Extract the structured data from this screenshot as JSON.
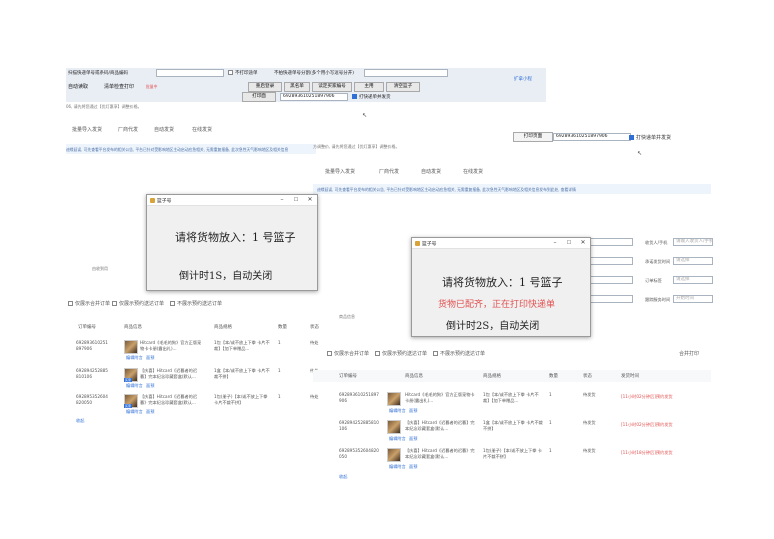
{
  "left": {
    "toolbar": {
      "hint_scan": "扫描快递单号或条码/商品编码 ",
      "print_label_chk": "不打印途单",
      "hint_small": "不拍快递单号分割(多个用小写逗号分开)",
      "cut_text": "扩拿小程",
      "btn_read_order": "自动读取",
      "btn_clear_print": "清单检查打印",
      "check_tag": "批量中",
      "btn_recheck": "重启登录",
      "btn_blacklist": "黑名单",
      "btn_confirm_vip": "读定买家编号",
      "btn_main": "主用",
      "btn_clear_basket": "清空篮子",
      "btn_print_page": "打印面",
      "code_value": "692893610251897906",
      "print_quick_chk": "打快递单并发货",
      "note": "06,  请先将您通过【优灯惠享】调整价格。"
    },
    "tabs": [
      "批量导入发货",
      "厂商代发",
      "自动发货",
      "在线发货"
    ],
    "notice": "迪缘延误,  可先查看平台发布的相关公告,  平台已针对受影响地区主动启动应急相关,  无需重复报备,  此次急性天气影响地区及相关信息",
    "filter_hint": "由收到用",
    "options": [
      "仅展示合并订单",
      "仅展示预约送达订单",
      "不展示预约送达订单"
    ],
    "columns": [
      "订单编号",
      "商品信息",
      "商品规格",
      "数量",
      "状态"
    ],
    "rows": [
      {
        "order": "692893610251897906",
        "title": "Hitcard《毛毛的狗》官方正版宠物卡卡册(露出礼)...",
        "spec": "1包【本/或不放上下拳 卡片不裁】【加下单赠品...",
        "qty": "1",
        "status": "待处"
      },
      {
        "order": "692894252885810106",
        "title": "【庆喜】Hitcard《迟暮者的迟暮】完本纪念珍藏套盒(默认...",
        "spec": "1盒【本/或不放上下拳 卡片不裁不拼】",
        "qty": "1",
        "status": "待处"
      },
      {
        "order": "692895352604820050",
        "title": "【庆喜】Hitcard《迟暮者的迟暮》完本纪念珍藏套盒(默认...",
        "spec": "1包(册子)【本/或不放上下拳 卡片不裁不拼】",
        "qty": "1",
        "status": "待处"
      }
    ],
    "links": [
      "编辑附言",
      "面预"
    ],
    "expand": "收起",
    "buyer_icon": "买家"
  },
  "dialog_left": {
    "title": "篮子号",
    "line1": "请将货物放入：1 号篮子",
    "line2": "倒计时1S，自动关闭"
  },
  "dialog_right": {
    "title": "篮子号",
    "line1": "请将货物放入：1 号篮子",
    "line_red": "货物已配齐，正在打印快递单",
    "line2": "倒计时2S，自动关闭"
  },
  "right": {
    "btn_print_page": "打印页面",
    "code_value": "692893610251897906",
    "print_quick_chk": "打快递单并发货",
    "note": "方调整价,  请先将您通过【优灯惠享】调整价格。",
    "tabs": [
      "批量导入发货",
      "厂商代发",
      "自动发货",
      "在线发货"
    ],
    "notice": "迪缘延误,  可先查看平台发布的相关公告,  平台已针对受影响地区主动启动应急相关,  无需重复报备,  此次急性天气影响地区及相关信息发布到此处,  查看详情",
    "fields": [
      {
        "label": "收货人/手机",
        "placeholder": "请输入收货人/手机"
      },
      {
        "label": "承诺发货时间",
        "placeholder": "请选择"
      },
      {
        "label": "订单标签",
        "placeholder": "请选择"
      },
      {
        "label": "跟踪服务时间",
        "placeholder": "开始时间"
      }
    ],
    "filter_hint": "商品信息",
    "options": [
      "仅展示合并订单",
      "仅展示预约送达订单",
      "不展示预约送达订单"
    ],
    "merge_print": "合并打印",
    "columns": [
      "订单编号",
      "商品信息",
      "商品规格",
      "数量",
      "状态",
      "发货时间"
    ],
    "rows": [
      {
        "order": "692893610251897906",
        "title": "Hitcard《毛毛的狗》官方正版宠物卡卡册(露出礼)...",
        "spec": "1包【本/或不放上下拳 卡片不裁】【加下单赠品...",
        "qty": "1",
        "status": "待发货",
        "ship": "[11小时02分钟后]预约发货"
      },
      {
        "order": "692894252885810106",
        "title": "【庆喜】Hitcard《迟暮者的迟暮】完本纪念珍藏套盒(默认...",
        "spec": "1盒【本/或不放上下拳 卡片不裁不拼】",
        "qty": "1",
        "status": "待发货",
        "ship": "[11小时02分钟后]预约发货"
      },
      {
        "order": "692895352604820050",
        "title": "【庆喜】Hitcard《迟暮者的迟暮》完本纪念珍藏套盒(默认...",
        "spec": "1包(册子)【本/或不放上下拳 卡片不裁不拼】",
        "qty": "1",
        "status": "待发货",
        "ship": "[11小时18分钟后]预约发货"
      }
    ],
    "links": [
      "编辑附言",
      "面预"
    ],
    "expand": "收起"
  },
  "colors": {
    "accent": "#2f6fd6",
    "red": "#e25050",
    "dialog_bg": "#f0f0f0"
  }
}
